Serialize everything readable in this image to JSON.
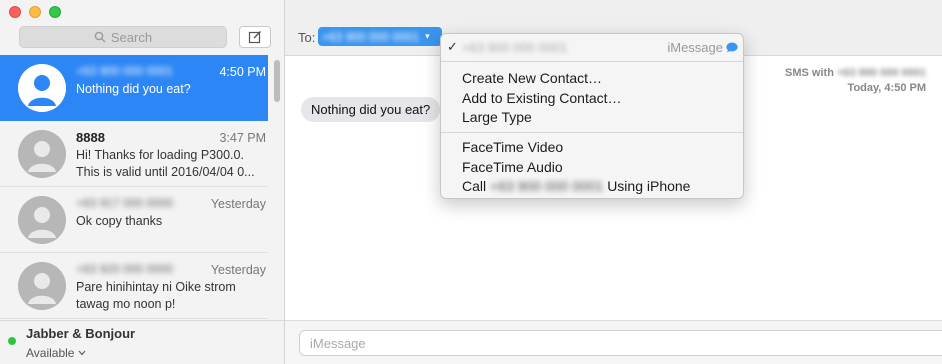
{
  "search": {
    "placeholder": "Search"
  },
  "conversations": [
    {
      "name": "+63 900 000 0001",
      "time": "4:50 PM",
      "preview": "Nothing did you eat?",
      "selected": true
    },
    {
      "name": "8888",
      "time": "3:47 PM",
      "preview_line1": "Hi! Thanks for loading P300.0.",
      "preview_line2": "This is valid until 2016/04/04 0..."
    },
    {
      "name": "+63 917 000 0000",
      "time": "Yesterday",
      "preview": "Ok copy thanks"
    },
    {
      "name": "+63 920 000 0000",
      "time": "Yesterday",
      "preview_line1": "Pare hinihintay ni Oike strom",
      "preview_line2": "tawag mo noon p!"
    }
  ],
  "status": {
    "service": "Jabber & Bonjour",
    "availability": "Available"
  },
  "header": {
    "to_label": "To:",
    "recipient": "+63 900 000 0001"
  },
  "thread": {
    "sms_with_label": "SMS with",
    "sms_with_number": "+63 900 000 0001",
    "timestamp": "Today, 4:50 PM",
    "message": "Nothing did you eat?"
  },
  "input": {
    "placeholder": "iMessage"
  },
  "menu": {
    "number": "+63 900 000 0001",
    "service": "iMessage",
    "items": {
      "create_contact": "Create New Contact…",
      "add_existing": "Add to Existing Contact…",
      "large_type": "Large Type",
      "facetime_video": "FaceTime Video",
      "facetime_audio": "FaceTime Audio",
      "call_prefix": "Call",
      "call_number": "+63 900 000 0001",
      "call_suffix": "Using iPhone"
    }
  },
  "colors": {
    "accent": "#2d86f5",
    "status_green": "#2bc640",
    "bubble_gray": "#e5e5ea"
  },
  "icons": [
    "search-icon",
    "compose-icon",
    "avatar-icon",
    "chevron-down-icon",
    "checkmark-icon",
    "imessage-bubble-icon"
  ]
}
